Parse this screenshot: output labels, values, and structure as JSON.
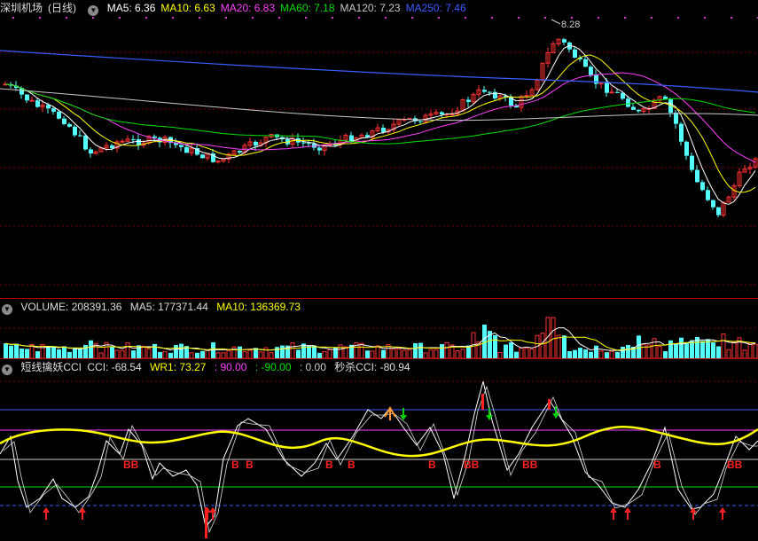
{
  "main": {
    "stock_name": "深圳机场",
    "period": "(日线)",
    "ma": [
      {
        "label": "MA5: 6.36",
        "color": "#ffffff"
      },
      {
        "label": "MA10: 6.63",
        "color": "#ffff00"
      },
      {
        "label": "MA20: 6.83",
        "color": "#ff40ff"
      },
      {
        "label": "MA60: 7.18",
        "color": "#00e000"
      },
      {
        "label": "MA120: 7.23",
        "color": "#c8c8c8"
      },
      {
        "label": "MA250: 7.46",
        "color": "#3a5cff"
      }
    ],
    "high_label": "8.28"
  },
  "volume": {
    "label": "VOLUME: 208391.36",
    "ma5": "MA5: 177371.44",
    "ma10": "MA10: 136369.73"
  },
  "indicator": {
    "name": "短线擒妖CCI",
    "cci": "CCI: -68.54",
    "wr1": "WR1: 73.27",
    "level_hi": ": 90.00",
    "level_lo": ": -90.00",
    "level_zero": ": 0.00",
    "miaosha": "秒杀CCI: -80.94",
    "signal_text": "B",
    "signal_text_double": "BB"
  },
  "colors": {
    "up": "#ff3232",
    "down": "#54ffff",
    "grid": "#7a0000",
    "separator": "#b00000"
  }
}
